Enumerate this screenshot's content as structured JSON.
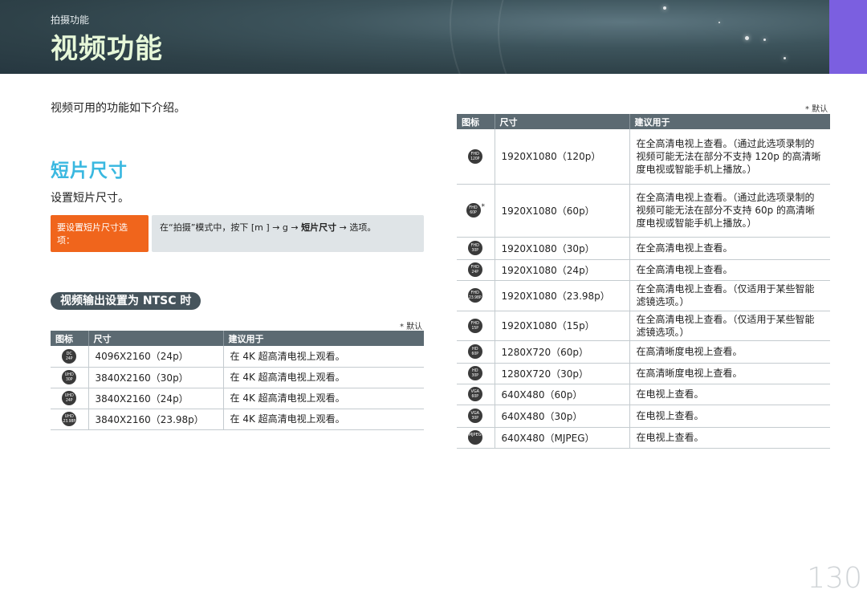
{
  "header": {
    "breadcrumb": "拍摄功能",
    "title": "视频功能"
  },
  "intro": "视频可用的功能如下介绍。",
  "section": {
    "title": "短片尺寸",
    "desc": "设置短片尺寸。"
  },
  "howto": {
    "label": "要设置短片尺寸选项：",
    "body_prefix": "在“拍摄”模式中，按下 [m",
    "body_mid": "] → g",
    "body_arrow": "→",
    "body_bold": "短片尺寸",
    "body_suffix": "→ 选项。"
  },
  "ntsc": {
    "label": "视频输出设置为 NTSC 时",
    "default_note": "* 默认",
    "headers": [
      "图标",
      "尺寸",
      "建议用于"
    ],
    "rows": [
      {
        "icon_top": "DC",
        "icon_bottom": "24P",
        "size": "4096X2160（24p）",
        "use": "在 4K 超高清电视上观看。"
      },
      {
        "icon_top": "UHD",
        "icon_bottom": "30P",
        "size": "3840X2160（30p）",
        "use": "在 4K 超高清电视上观看。"
      },
      {
        "icon_top": "UHD",
        "icon_bottom": "24P",
        "size": "3840X2160（24p）",
        "use": "在 4K 超高清电视上观看。"
      },
      {
        "icon_top": "UHD",
        "icon_bottom": "23.98P",
        "size": "3840X2160（23.98p）",
        "use": "在 4K 超高清电视上观看。"
      }
    ]
  },
  "right_table": {
    "default_note": "* 默认",
    "headers": [
      "图标",
      "尺寸",
      "建议用于"
    ],
    "rows": [
      {
        "icon_top": "FHD",
        "icon_bottom": "120P",
        "star": "",
        "size": "1920X1080（120p）",
        "use": "在全高清电视上查看。（通过此选项录制的视频可能无法在部分不支持 120p 的高清晰度电视或智能手机上播放。）"
      },
      {
        "icon_top": "FHD",
        "icon_bottom": "60P",
        "star": "*",
        "size": "1920X1080（60p）",
        "use": "在全高清电视上查看。（通过此选项录制的视频可能无法在部分不支持 60p 的高清晰度电视或智能手机上播放。）"
      },
      {
        "icon_top": "FHD",
        "icon_bottom": "30P",
        "star": "",
        "size": "1920X1080（30p）",
        "use": "在全高清电视上查看。"
      },
      {
        "icon_top": "FHD",
        "icon_bottom": "24P",
        "star": "",
        "size": "1920X1080（24p）",
        "use": "在全高清电视上查看。"
      },
      {
        "icon_top": "FHD",
        "icon_bottom": "23.98P",
        "star": "",
        "size": "1920X1080（23.98p）",
        "use": "在全高清电视上查看。（仅适用于某些智能滤镜选项。）"
      },
      {
        "icon_top": "FHD",
        "icon_bottom": "15P",
        "star": "",
        "size": "1920X1080（15p）",
        "use": "在全高清电视上查看。（仅适用于某些智能滤镜选项。）"
      },
      {
        "icon_top": "HD",
        "icon_bottom": "60P",
        "star": "",
        "size": "1280X720（60p）",
        "use": "在高清晰度电视上查看。"
      },
      {
        "icon_top": "HD",
        "icon_bottom": "30P",
        "star": "",
        "size": "1280X720（30p）",
        "use": "在高清晰度电视上查看。"
      },
      {
        "icon_top": "VGA",
        "icon_bottom": "60P",
        "star": "",
        "size": "640X480（60p）",
        "use": "在电视上查看。"
      },
      {
        "icon_top": "VGA",
        "icon_bottom": "30P",
        "star": "",
        "size": "640X480（30p）",
        "use": "在电视上查看。"
      },
      {
        "icon_top": "MJPEG",
        "icon_bottom": "",
        "star": "",
        "size": "640X480（MJPEG）",
        "use": "在电视上查看。"
      }
    ]
  },
  "page_number": "130"
}
